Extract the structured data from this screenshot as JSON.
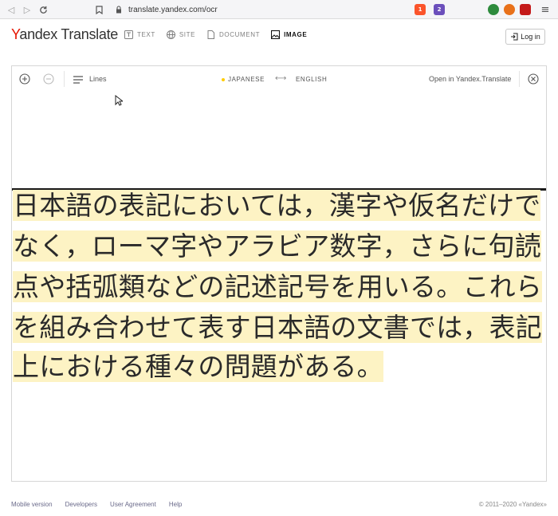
{
  "browser": {
    "url": "translate.yandex.com/ocr",
    "badges": {
      "shield": "1",
      "alert": "2"
    }
  },
  "header": {
    "logo_first": "Y",
    "logo_rest": "andex",
    "logo_suffix": "Translate",
    "tabs": [
      {
        "label": "TEXT",
        "icon": "text-icon"
      },
      {
        "label": "SITE",
        "icon": "globe-icon"
      },
      {
        "label": "DOCUMENT",
        "icon": "document-icon"
      },
      {
        "label": "IMAGE",
        "icon": "image-icon",
        "active": true
      }
    ],
    "login_label": "Log in"
  },
  "toolbar": {
    "lines_label": "Lines",
    "source_lang": "JAPANESE",
    "swap_symbol": "⟷",
    "target_lang": "ENGLISH",
    "open_label": "Open in Yandex.Translate"
  },
  "image_text": {
    "lines": [
      "日本語の表記においては，漢字や仮名だけで",
      "なく，ローマ字やアラビア数字，さらに句読",
      "点や括弧類などの記述記号を用いる。これら",
      "を組み合わせて表す日本語の文書では，表記",
      "上における種々の問題がある。"
    ]
  },
  "footer": {
    "links": [
      "Mobile version",
      "Developers",
      "User Agreement",
      "Help"
    ],
    "copyright": "© 2011–2020 «Yandex»"
  },
  "colors": {
    "brand_red": "#e61400",
    "highlight": "#fdf3c4",
    "source_dot": "#ffcc00"
  }
}
